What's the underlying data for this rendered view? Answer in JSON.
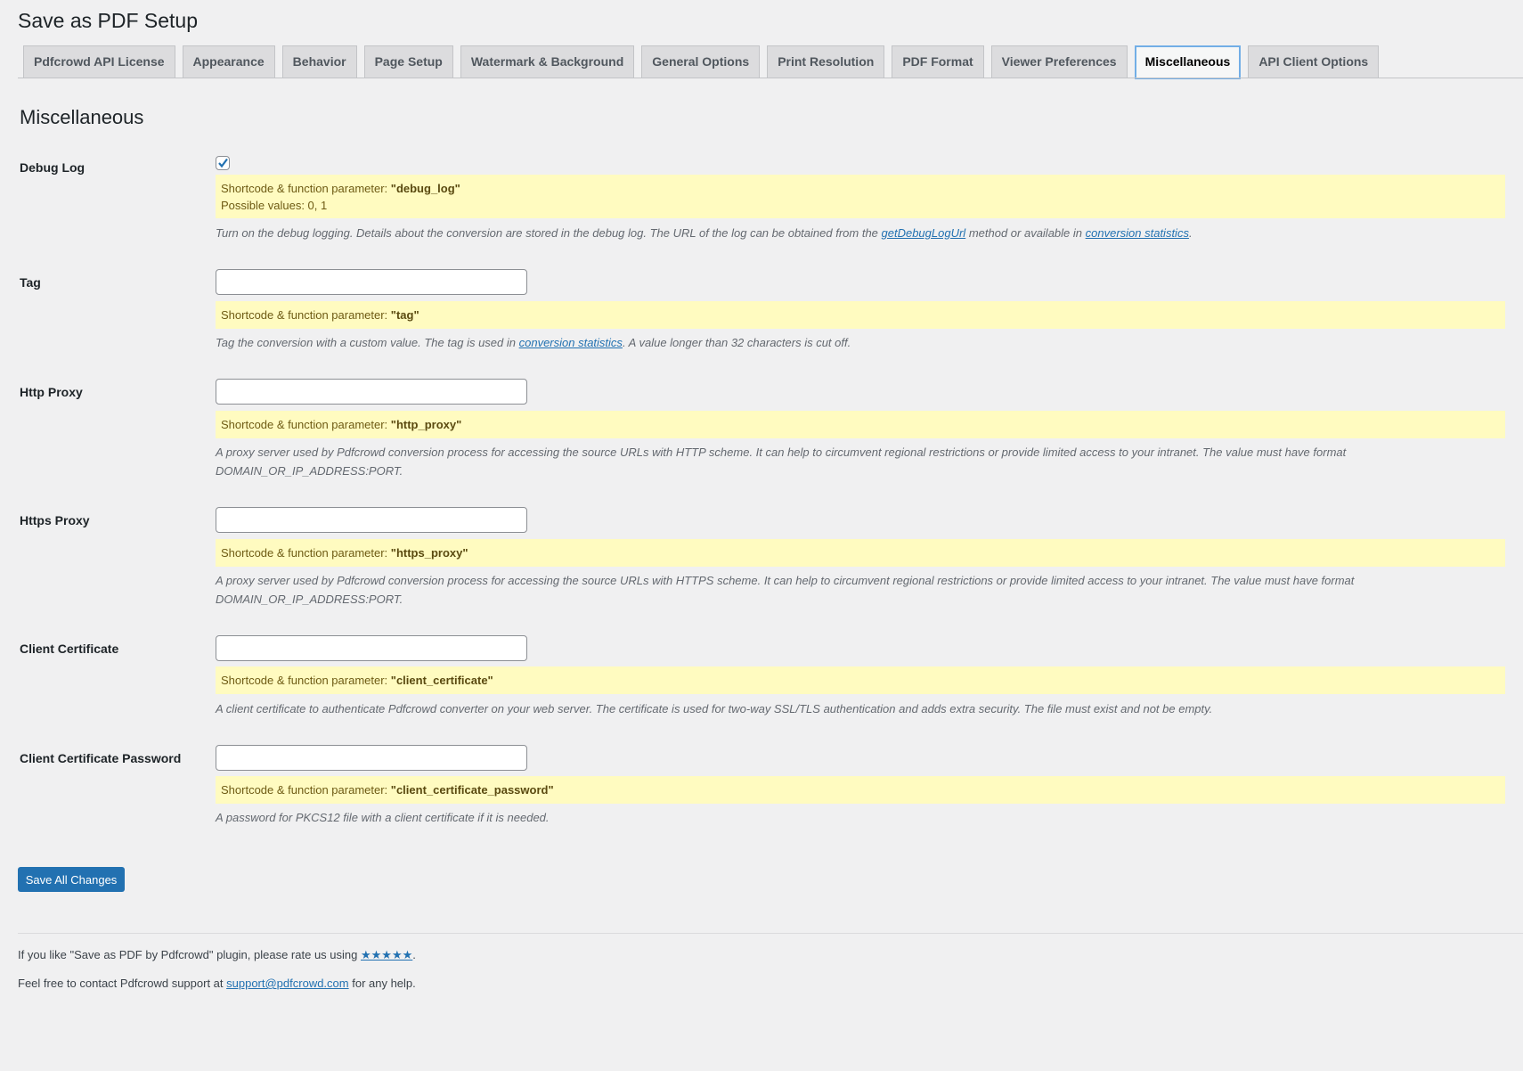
{
  "page_title": "Save as PDF Setup",
  "tabs": [
    {
      "label": "Pdfcrowd API License"
    },
    {
      "label": "Appearance"
    },
    {
      "label": "Behavior"
    },
    {
      "label": "Page Setup"
    },
    {
      "label": "Watermark & Background"
    },
    {
      "label": "General Options"
    },
    {
      "label": "Print Resolution"
    },
    {
      "label": "PDF Format"
    },
    {
      "label": "Viewer Preferences"
    },
    {
      "label": "Miscellaneous",
      "active": true
    },
    {
      "label": "API Client Options"
    }
  ],
  "section_title": "Miscellaneous",
  "param_prefix": "Shortcode & function parameter: ",
  "fields": {
    "debug_log": {
      "label": "Debug Log",
      "checked": true,
      "param": "\"debug_log\"",
      "possible": "Possible values: 0, 1",
      "desc_1": "Turn on the debug logging. Details about the conversion are stored in the debug log. The URL of the log can be obtained from the ",
      "link_1": "getDebugLogUrl",
      "desc_2": " method or available in ",
      "link_2": "conversion statistics",
      "desc_3": "."
    },
    "tag": {
      "label": "Tag",
      "value": "",
      "param": "\"tag\"",
      "desc_1": "Tag the conversion with a custom value. The tag is used in ",
      "link_1": "conversion statistics",
      "desc_2": ". A value longer than 32 characters is cut off."
    },
    "http_proxy": {
      "label": "Http Proxy",
      "value": "",
      "param": "\"http_proxy\"",
      "desc": "A proxy server used by Pdfcrowd conversion process for accessing the source URLs with HTTP scheme. It can help to circumvent regional restrictions or provide limited access to your intranet. The value must have format DOMAIN_OR_IP_ADDRESS:PORT."
    },
    "https_proxy": {
      "label": "Https Proxy",
      "value": "",
      "param": "\"https_proxy\"",
      "desc": "A proxy server used by Pdfcrowd conversion process for accessing the source URLs with HTTPS scheme. It can help to circumvent regional restrictions or provide limited access to your intranet. The value must have format DOMAIN_OR_IP_ADDRESS:PORT."
    },
    "client_certificate": {
      "label": "Client Certificate",
      "value": "",
      "param": "\"client_certificate\"",
      "desc": "A client certificate to authenticate Pdfcrowd converter on your web server. The certificate is used for two-way SSL/TLS authentication and adds extra security. The file must exist and not be empty."
    },
    "client_certificate_password": {
      "label": "Client Certificate Password",
      "value": "",
      "param": "\"client_certificate_password\"",
      "desc": "A password for PKCS12 file with a client certificate if it is needed."
    }
  },
  "save_label": "Save All Changes",
  "footer": {
    "rate_text": "If you like \"Save as PDF by Pdfcrowd\" plugin, please rate us using ",
    "rate_link": "★★★★★",
    "rate_end": ".",
    "contact_text": "Feel free to contact Pdfcrowd support at ",
    "contact_link": "support@pdfcrowd.com",
    "contact_end": " for any help."
  },
  "colors": {
    "accent": "#2271b1",
    "note_bg": "#fffbc0"
  }
}
